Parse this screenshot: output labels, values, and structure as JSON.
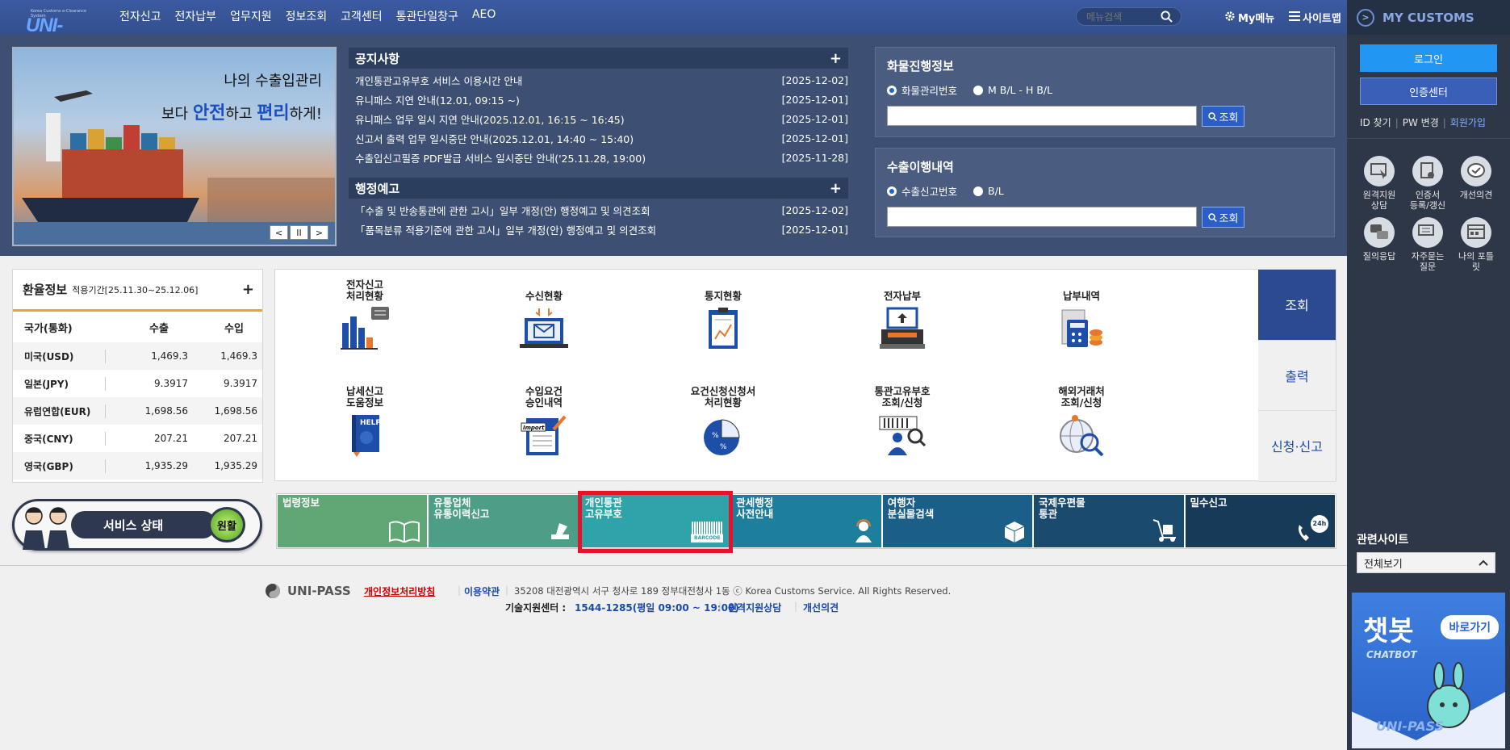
{
  "header": {
    "logo_tagline": "Korea Customs e-Clearance System",
    "logo_text": "UNI-PASS",
    "nav": [
      "전자신고",
      "전자납부",
      "업무지원",
      "정보조회",
      "고객센터",
      "통관단일창구",
      "AEO"
    ],
    "search_placeholder": "메뉴검색",
    "mymenu": "My메뉴",
    "sitemap": "사이트맵"
  },
  "right_panel": {
    "title": "MY CUSTOMS",
    "login": "로그인",
    "cert": "인증센터",
    "links": [
      "ID 찾기",
      "PW 변경",
      "회원가입"
    ],
    "quick": [
      {
        "label": "원격지원\n상담",
        "icon": "remote-support-icon"
      },
      {
        "label": "인증서\n등록/갱신",
        "icon": "certificate-icon"
      },
      {
        "label": "개선의견",
        "icon": "chat-bubble-icon"
      },
      {
        "label": "질의응답",
        "icon": "qna-icon"
      },
      {
        "label": "자주묻는\n질문",
        "icon": "faq-icon"
      },
      {
        "label": "나의 포틀\n릿",
        "icon": "portlet-icon"
      }
    ],
    "related_title": "관련사이트",
    "related_select": "전체보기",
    "chatbot_title": "챗봇",
    "chatbot_sub": "CHATBOT",
    "chatbot_btn": "바로가기",
    "chatbot_brand": "UNI-PASS"
  },
  "banner": {
    "line1": "나의 수출입관리",
    "line2_pre": "보다 ",
    "line2_em1": "안전",
    "line2_mid": "하고 ",
    "line2_em2": "편리",
    "line2_post": "하게!",
    "ctrl": [
      "<",
      "II",
      ">"
    ]
  },
  "notices": {
    "title": "공지사항",
    "items": [
      {
        "text": "개인통관고유부호 서비스 이용시간 안내",
        "date": "[2025-12-02]"
      },
      {
        "text": "유니패스 지연 안내(12.01, 09:15 ~)",
        "date": "[2025-12-01]"
      },
      {
        "text": "유니패스 업무 일시 지연 안내(2025.12.01, 16:15 ~ 16:45)",
        "date": "[2025-12-01]"
      },
      {
        "text": "신고서 출력 업무 일시중단 안내(2025.12.01, 14:40 ~ 15:40)",
        "date": "[2025-12-01]"
      },
      {
        "text": "수출입신고필증 PDF발급 서비스 일시중단 안내('25.11.28, 19:00)",
        "date": "[2025-11-28]"
      }
    ]
  },
  "admin_notice": {
    "title": "행정예고",
    "items": [
      {
        "text": "「수출 및 반송통관에 관한 고시」일부 개정(안) 행정예고 및 의견조회",
        "date": "[2025-12-02]"
      },
      {
        "text": "「품목분류 적용기준에 관한 고시」일부 개정(안) 행정예고 및 의견조회",
        "date": "[2025-12-01]"
      }
    ]
  },
  "cargo": {
    "title": "화물진행정보",
    "radio1": "화물관리번호",
    "radio2": "M B/L - H B/L",
    "btn": "조회"
  },
  "export_hist": {
    "title": "수출이행내역",
    "radio1": "수출신고번호",
    "radio2": "B/L",
    "btn": "조회"
  },
  "rates": {
    "title": "환율정보",
    "period": "적용기간[25.11.30~25.12.06]",
    "headers": [
      "국가(통화)",
      "수출",
      "수입"
    ],
    "rows": [
      [
        "미국(USD)",
        "1,469.3",
        "1,469.3"
      ],
      [
        "일본(JPY)",
        "9.3917",
        "9.3917"
      ],
      [
        "유럽연합(EUR)",
        "1,698.56",
        "1,698.56"
      ],
      [
        "중국(CNY)",
        "207.21",
        "207.21"
      ],
      [
        "영국(GBP)",
        "1,935.29",
        "1,935.29"
      ]
    ]
  },
  "service_status": {
    "label": "서비스 상태",
    "status": "원활"
  },
  "services": [
    {
      "label": "전자신고\n처리현황"
    },
    {
      "label": "수신현황"
    },
    {
      "label": "통지현황"
    },
    {
      "label": "전자납부"
    },
    {
      "label": "납부내역"
    },
    {
      "label": "납세신고\n도움정보"
    },
    {
      "label": "수입요건\n승인내역"
    },
    {
      "label": "요건신청신청서\n처리현황"
    },
    {
      "label": "통관고유부호\n조회/신청"
    },
    {
      "label": "해외거래처\n조회/신청"
    }
  ],
  "side_tabs": [
    "조회",
    "출력",
    "신청·신고"
  ],
  "tiles": [
    {
      "label": "법령정보",
      "color": "#5fa775"
    },
    {
      "label": "유통업체\n유통이력신고",
      "color": "#4e9e87"
    },
    {
      "label": "개인통관\n고유부호",
      "color": "#2ea3a8",
      "icon_text": "BARCODE"
    },
    {
      "label": "관세행정\n사전안내",
      "color": "#1d7f9c"
    },
    {
      "label": "여행자\n분실물검색",
      "color": "#1b5e87"
    },
    {
      "label": "국제우편물\n통관",
      "color": "#1a4a6e"
    },
    {
      "label": "밀수신고",
      "color": "#173a58",
      "icon_text": "24h"
    }
  ],
  "footer": {
    "logo": "UNI-PASS",
    "privacy": "개인정보처리방침",
    "terms": "이용약관",
    "address": "35208 대전광역시 서구 청사로 189 정부대전청사 1동 ⓒ Korea Customs Service. All Rights Reserved.",
    "tech_label": "기술지원센터 :",
    "tech_phone": "1544-1285(평일 09:00 ~ 19:00)",
    "remote": "원격지원상담",
    "feedback": "개선의견"
  },
  "colors": {
    "accent": "#2b5fc7",
    "highlight": "#e8102a",
    "header": "#3b5aa0"
  }
}
